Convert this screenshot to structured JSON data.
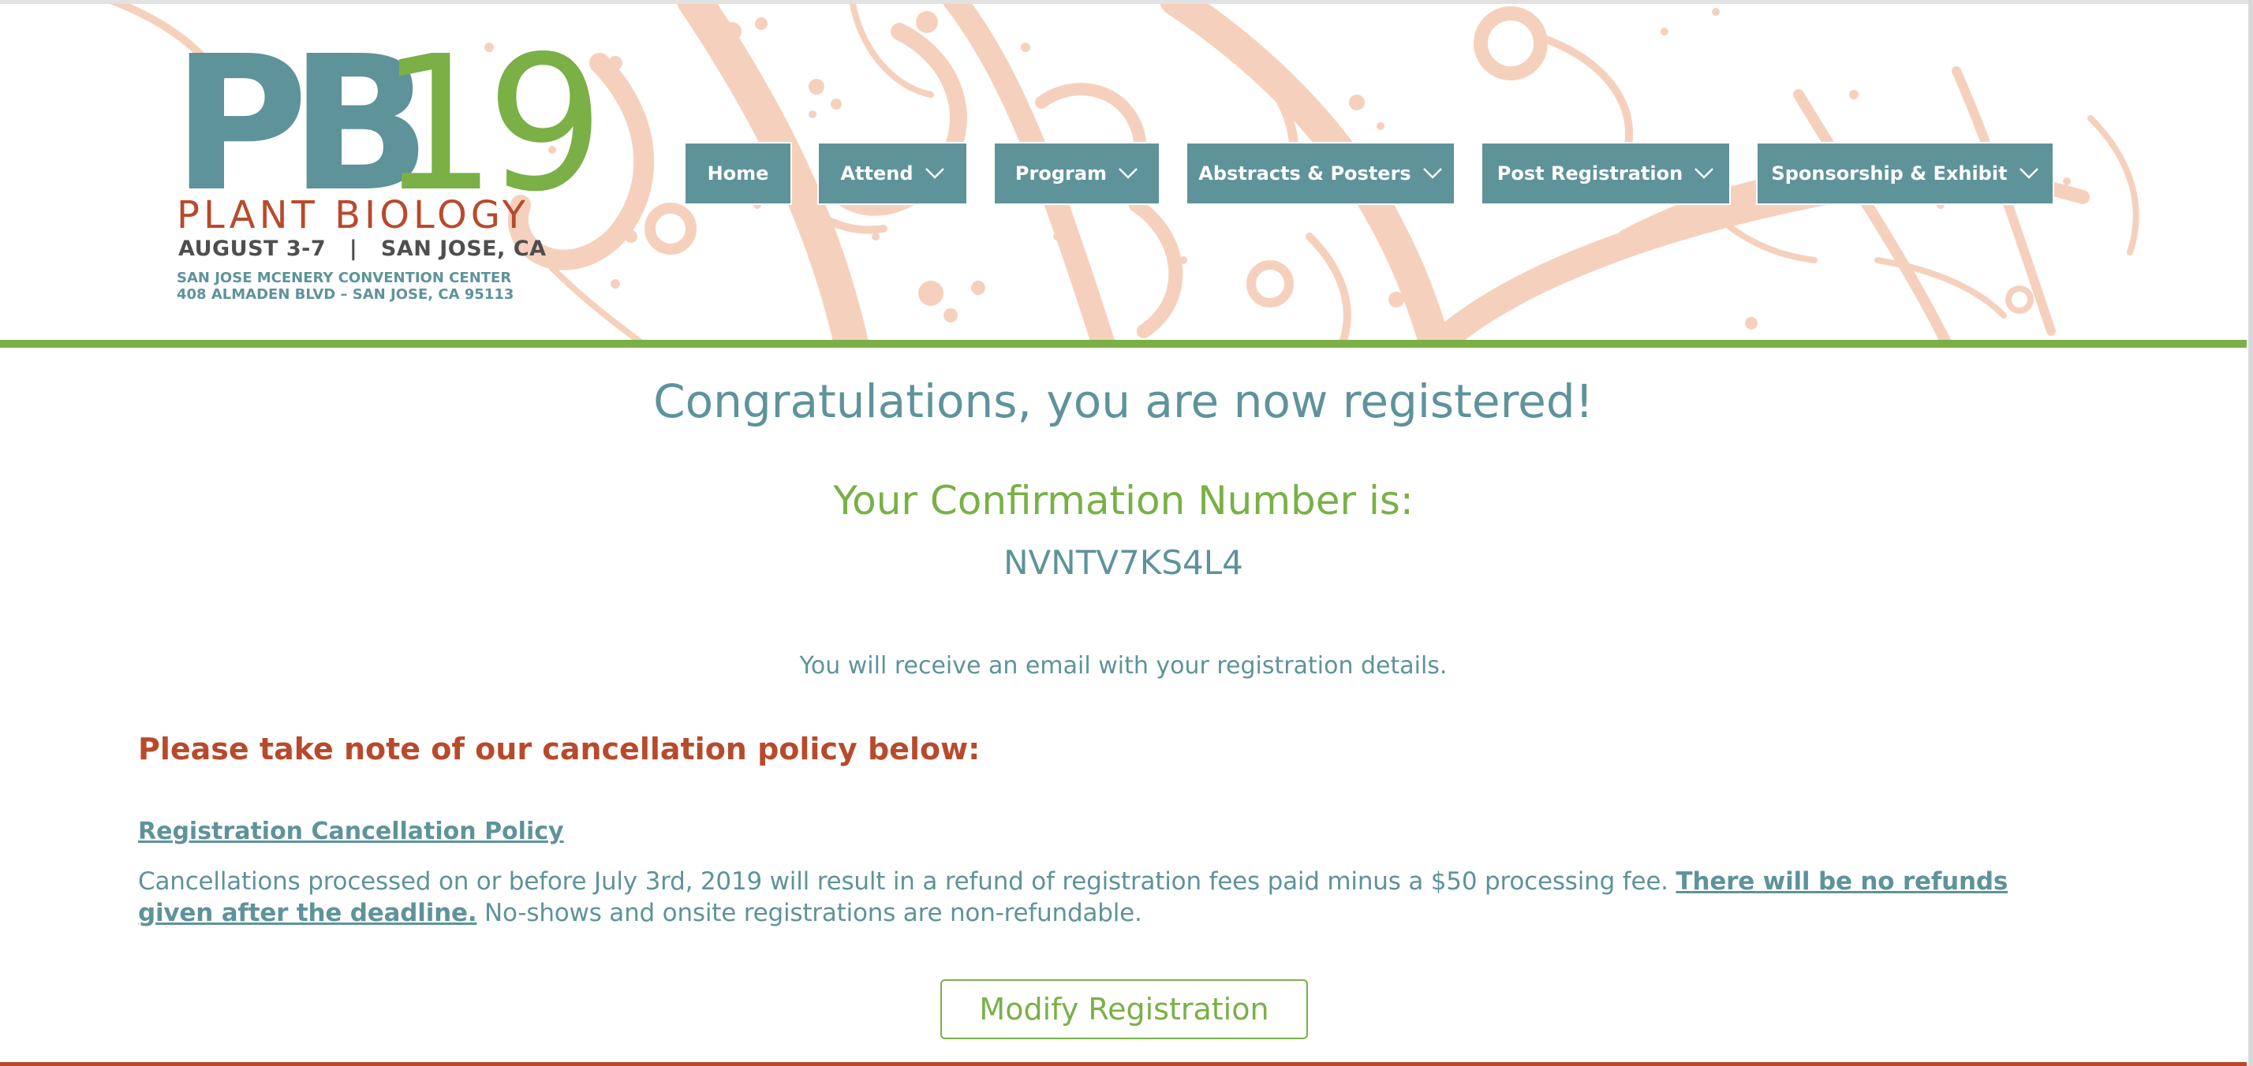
{
  "colors": {
    "teal": "#5e939a",
    "green": "#7ab046",
    "rust": "#b84a2c",
    "swirl": "#f5d1bd",
    "nav_text": "#ffffff"
  },
  "logo": {
    "pb": "PB",
    "number": "19",
    "subtitle": "PLANT BIOLOGY",
    "dates": "AUGUST 3-7   |   SAN JOSE, CA",
    "venue": "SAN JOSE MCENERY CONVENTION CENTER",
    "address": "408 ALMADEN BLVD – SAN JOSE, CA 95113"
  },
  "nav": {
    "items": [
      {
        "label": "Home",
        "has_dropdown": false,
        "icon": null
      },
      {
        "label": "Attend",
        "has_dropdown": true,
        "icon": "chevron-down-icon"
      },
      {
        "label": "Program",
        "has_dropdown": true,
        "icon": "chevron-down-icon"
      },
      {
        "label": "Abstracts & Posters",
        "has_dropdown": true,
        "icon": "chevron-down-icon"
      },
      {
        "label": "Post Registration",
        "has_dropdown": true,
        "icon": "chevron-down-icon"
      },
      {
        "label": "Sponsorship & Exhibit",
        "has_dropdown": true,
        "icon": "chevron-down-icon"
      }
    ]
  },
  "main": {
    "heading": "Congratulations, you are now registered!",
    "confirmation_label": "Your Confirmation Number is:",
    "confirmation_number": "NVNTV7KS4L4",
    "email_note": "You will receive an email with your registration details.",
    "policy_heading": "Please take note of our cancellation policy below:",
    "policy_link": "Registration Cancellation Policy",
    "policy_text_1": "Cancellations processed on or before July 3rd, 2019 will result in a refund of registration fees paid minus a $50 processing fee. ",
    "policy_text_bold": "There will be no refunds given after the deadline.",
    "policy_text_2": " No-shows and onsite registrations are non-refundable.",
    "modify_button": "Modify Registration"
  }
}
